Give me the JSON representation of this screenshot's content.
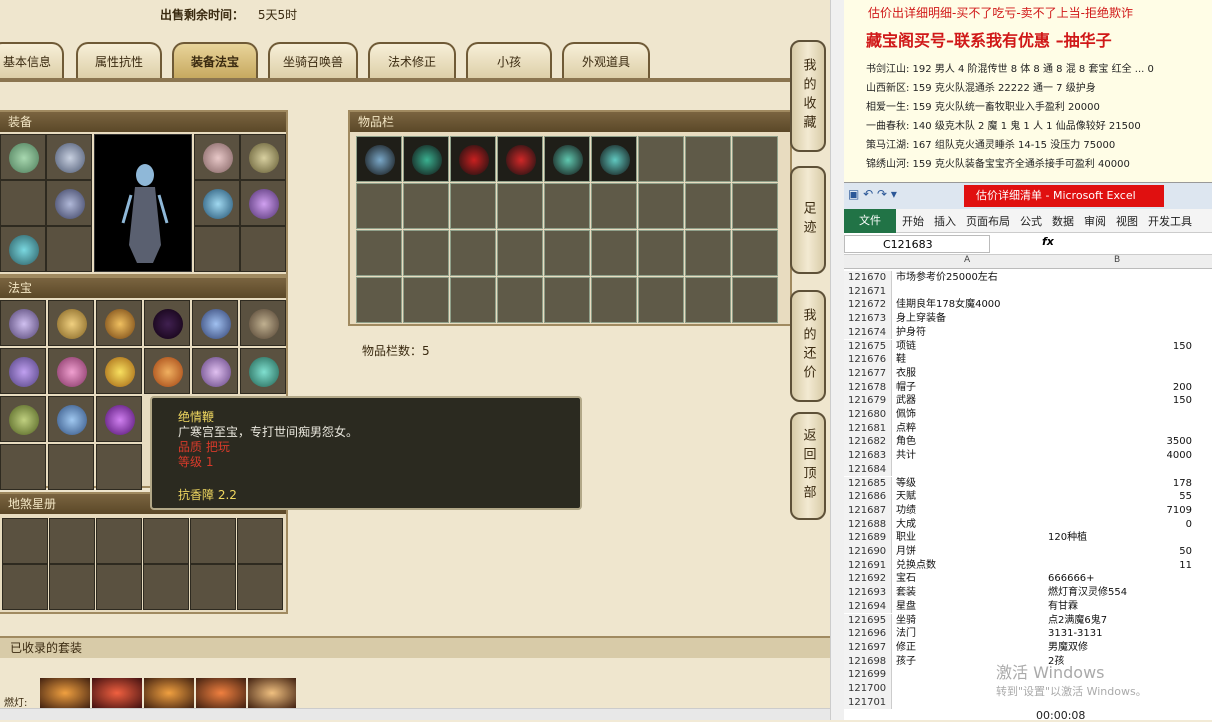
{
  "game": {
    "timer_label": "出售剩余时间：",
    "timer_value": "5天5时",
    "tabs": [
      "基本信息",
      "属性抗性",
      "装备法宝",
      "坐骑召唤兽",
      "法术修正",
      "小孩",
      "外观道具"
    ],
    "equip_title": "装备",
    "treasure_title": "法宝",
    "star_title": "地煞星册",
    "inventory_title": "物品栏",
    "inventory_count": "物品栏数：5",
    "suits_title": "已收录的套装",
    "suit_row_label": "燃灯:",
    "side_buttons": [
      "我的收藏",
      "足迹",
      "我的还价",
      "返回顶部"
    ],
    "tooltip": {
      "name": "绝情鞭",
      "desc": "广寒宫至宝，专打世间痴男怨女。",
      "quality": "品质  把玩",
      "level": "等级  1",
      "attr": "抗香障 2.2"
    }
  },
  "ad": {
    "line1": "估价出详细明细-买不了吃亏-卖不了上当-拒绝欺诈",
    "line2": "藏宝阁买号–联系我有优惠 –抽华子",
    "lines": [
      "书剑江山: 192 男人 4 阶混传世 8 体 8 通 8 混 8 套宝 红全 ... 0",
      "山西新区: 159 克火队混通杀 22222 通一 7 级护身",
      "相爱一生: 159 克火队统一畜牧职业入手盈利 20000",
      "一曲春秋: 140 级克木队 2 魔 1 鬼 1 人 1 仙品像较好 21500",
      "策马江湖: 167 组队克火通灵睡杀 14-15 没压力 75000",
      "锦绣山河: 159 克火队装备宝宝齐全通杀接手可盈利 40000"
    ]
  },
  "excel": {
    "title": "估价详细清单 - Microsoft Excel",
    "ribbon": [
      "文件",
      "开始",
      "插入",
      "页面布局",
      "公式",
      "数据",
      "审阅",
      "视图",
      "开发工具"
    ],
    "namebox": "C121683",
    "col_a": "A",
    "col_b": "B",
    "rows": [
      {
        "n": "121670",
        "a": "市场参考价25000左右",
        "b": ""
      },
      {
        "n": "121671",
        "a": "",
        "b": ""
      },
      {
        "n": "121672",
        "a": "佳期良年178女魔4000",
        "b": ""
      },
      {
        "n": "121673",
        "a": "身上穿装备",
        "b": ""
      },
      {
        "n": "121674",
        "a": "护身符",
        "b": ""
      },
      {
        "n": "121675",
        "a": "项链",
        "b": "150"
      },
      {
        "n": "121676",
        "a": "鞋",
        "b": ""
      },
      {
        "n": "121677",
        "a": "衣服",
        "b": ""
      },
      {
        "n": "121678",
        "a": "帽子",
        "b": "200"
      },
      {
        "n": "121679",
        "a": "武器",
        "b": "150"
      },
      {
        "n": "121680",
        "a": "佩饰",
        "b": ""
      },
      {
        "n": "121681",
        "a": "点粹",
        "b": ""
      },
      {
        "n": "121682",
        "a": "角色",
        "b": "3500"
      },
      {
        "n": "121683",
        "a": "共计",
        "b": "4000"
      },
      {
        "n": "121684",
        "a": "",
        "b": ""
      },
      {
        "n": "121685",
        "a": "等级",
        "b": "178"
      },
      {
        "n": "121686",
        "a": "天赋",
        "b": "55"
      },
      {
        "n": "121687",
        "a": "功绩",
        "b": "7109"
      },
      {
        "n": "121688",
        "a": "大成",
        "b": "0"
      },
      {
        "n": "121689",
        "a": "职业",
        "b": "120种植"
      },
      {
        "n": "121690",
        "a": "月饼",
        "b": "50"
      },
      {
        "n": "121691",
        "a": "兑换点数",
        "b": "11"
      },
      {
        "n": "121692",
        "a": "宝石",
        "b": "666666+"
      },
      {
        "n": "121693",
        "a": "套装",
        "b": "燃灯育汉灵修554"
      },
      {
        "n": "121694",
        "a": "星盘",
        "b": "有甘霖"
      },
      {
        "n": "121695",
        "a": "坐骑",
        "b": "点2满魔6鬼7"
      },
      {
        "n": "121696",
        "a": "法门",
        "b": "3131-3131"
      },
      {
        "n": "121697",
        "a": "修正",
        "b": "男魔双修"
      },
      {
        "n": "121698",
        "a": "孩子",
        "b": "2孩"
      },
      {
        "n": "121699",
        "a": "",
        "b": ""
      },
      {
        "n": "121700",
        "a": "",
        "b": ""
      },
      {
        "n": "121701",
        "a": "",
        "b": ""
      }
    ],
    "watermark1": "激活 Windows",
    "watermark2": "转到\"设置\"以激活 Windows。",
    "video_time": "00:00:08"
  },
  "colors": {
    "tab_active": "#c7a960",
    "panel_head": "#5b4828",
    "excel_green": "#217346",
    "ad_red": "#d01818"
  }
}
